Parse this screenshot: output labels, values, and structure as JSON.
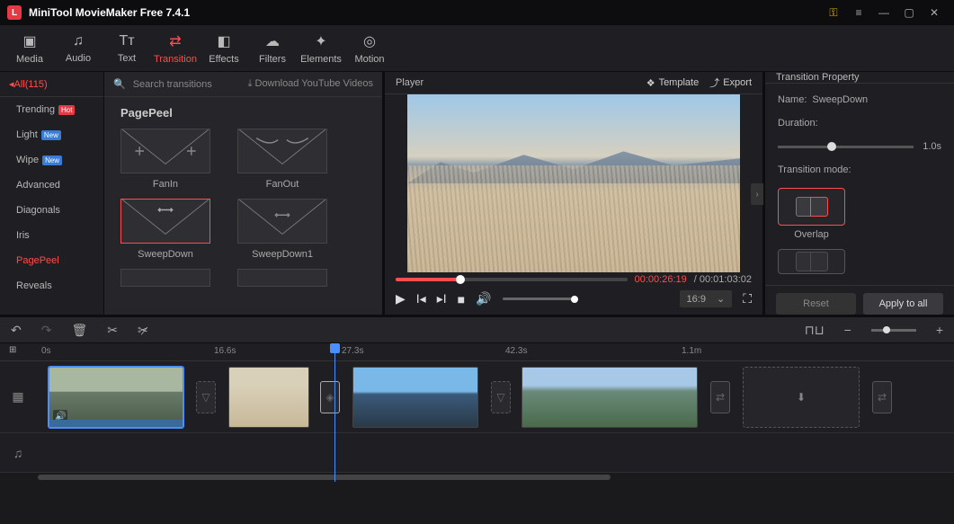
{
  "app": {
    "title": "MiniTool MovieMaker Free 7.4.1"
  },
  "nav": {
    "items": [
      {
        "label": "Media"
      },
      {
        "label": "Audio"
      },
      {
        "label": "Text"
      },
      {
        "label": "Transition"
      },
      {
        "label": "Effects"
      },
      {
        "label": "Filters"
      },
      {
        "label": "Elements"
      },
      {
        "label": "Motion"
      }
    ]
  },
  "categories": {
    "all": "All(115)",
    "items": [
      {
        "label": "Trending",
        "badge": "Hot"
      },
      {
        "label": "Light",
        "badge": "New"
      },
      {
        "label": "Wipe",
        "badge": "New"
      },
      {
        "label": "Advanced"
      },
      {
        "label": "Diagonals"
      },
      {
        "label": "Iris"
      },
      {
        "label": "PagePeel"
      },
      {
        "label": "Reveals"
      }
    ]
  },
  "transitions": {
    "search_placeholder": "Search transitions",
    "download": "Download YouTube Videos",
    "section": "PagePeel",
    "items": [
      {
        "label": "FanIn"
      },
      {
        "label": "FanOut"
      },
      {
        "label": "SweepDown"
      },
      {
        "label": "SweepDown1"
      }
    ]
  },
  "player": {
    "title": "Player",
    "template": "Template",
    "export": "Export",
    "time_current": "00:00:26:19",
    "time_total": "00:01:03:02",
    "ratio": "16:9"
  },
  "property": {
    "title": "Transition Property",
    "name_label": "Name:",
    "name_value": "SweepDown",
    "duration_label": "Duration:",
    "duration_value": "1.0s",
    "mode_label": "Transition mode:",
    "mode_overlap": "Overlap",
    "reset": "Reset",
    "apply_all": "Apply to all"
  },
  "timeline": {
    "ticks": [
      "0s",
      "16.6s",
      "27.3s",
      "42.3s",
      "1.1m"
    ]
  }
}
